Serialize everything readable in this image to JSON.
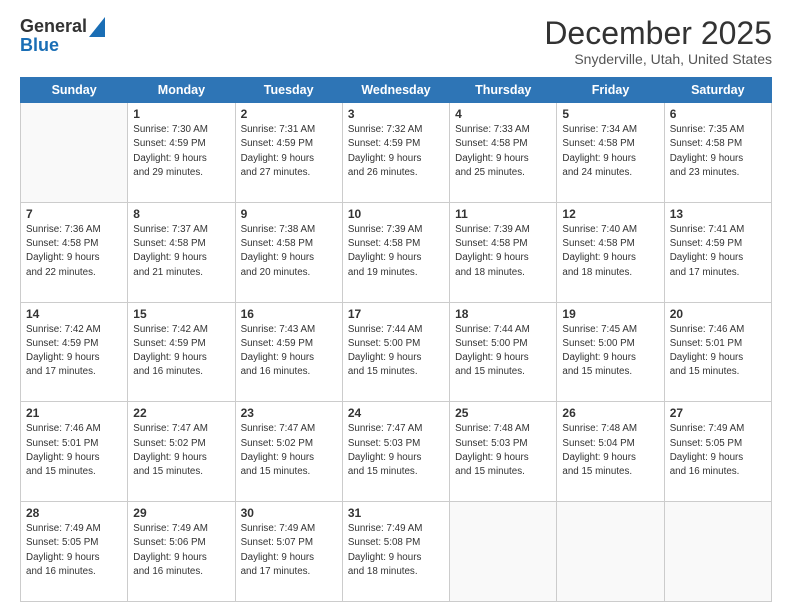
{
  "logo": {
    "line1": "General",
    "line2": "Blue"
  },
  "title": "December 2025",
  "subtitle": "Snyderville, Utah, United States",
  "days_of_week": [
    "Sunday",
    "Monday",
    "Tuesday",
    "Wednesday",
    "Thursday",
    "Friday",
    "Saturday"
  ],
  "weeks": [
    [
      {
        "day": "",
        "info": ""
      },
      {
        "day": "1",
        "info": "Sunrise: 7:30 AM\nSunset: 4:59 PM\nDaylight: 9 hours\nand 29 minutes."
      },
      {
        "day": "2",
        "info": "Sunrise: 7:31 AM\nSunset: 4:59 PM\nDaylight: 9 hours\nand 27 minutes."
      },
      {
        "day": "3",
        "info": "Sunrise: 7:32 AM\nSunset: 4:59 PM\nDaylight: 9 hours\nand 26 minutes."
      },
      {
        "day": "4",
        "info": "Sunrise: 7:33 AM\nSunset: 4:58 PM\nDaylight: 9 hours\nand 25 minutes."
      },
      {
        "day": "5",
        "info": "Sunrise: 7:34 AM\nSunset: 4:58 PM\nDaylight: 9 hours\nand 24 minutes."
      },
      {
        "day": "6",
        "info": "Sunrise: 7:35 AM\nSunset: 4:58 PM\nDaylight: 9 hours\nand 23 minutes."
      }
    ],
    [
      {
        "day": "7",
        "info": "Sunrise: 7:36 AM\nSunset: 4:58 PM\nDaylight: 9 hours\nand 22 minutes."
      },
      {
        "day": "8",
        "info": "Sunrise: 7:37 AM\nSunset: 4:58 PM\nDaylight: 9 hours\nand 21 minutes."
      },
      {
        "day": "9",
        "info": "Sunrise: 7:38 AM\nSunset: 4:58 PM\nDaylight: 9 hours\nand 20 minutes."
      },
      {
        "day": "10",
        "info": "Sunrise: 7:39 AM\nSunset: 4:58 PM\nDaylight: 9 hours\nand 19 minutes."
      },
      {
        "day": "11",
        "info": "Sunrise: 7:39 AM\nSunset: 4:58 PM\nDaylight: 9 hours\nand 18 minutes."
      },
      {
        "day": "12",
        "info": "Sunrise: 7:40 AM\nSunset: 4:58 PM\nDaylight: 9 hours\nand 18 minutes."
      },
      {
        "day": "13",
        "info": "Sunrise: 7:41 AM\nSunset: 4:59 PM\nDaylight: 9 hours\nand 17 minutes."
      }
    ],
    [
      {
        "day": "14",
        "info": "Sunrise: 7:42 AM\nSunset: 4:59 PM\nDaylight: 9 hours\nand 17 minutes."
      },
      {
        "day": "15",
        "info": "Sunrise: 7:42 AM\nSunset: 4:59 PM\nDaylight: 9 hours\nand 16 minutes."
      },
      {
        "day": "16",
        "info": "Sunrise: 7:43 AM\nSunset: 4:59 PM\nDaylight: 9 hours\nand 16 minutes."
      },
      {
        "day": "17",
        "info": "Sunrise: 7:44 AM\nSunset: 5:00 PM\nDaylight: 9 hours\nand 15 minutes."
      },
      {
        "day": "18",
        "info": "Sunrise: 7:44 AM\nSunset: 5:00 PM\nDaylight: 9 hours\nand 15 minutes."
      },
      {
        "day": "19",
        "info": "Sunrise: 7:45 AM\nSunset: 5:00 PM\nDaylight: 9 hours\nand 15 minutes."
      },
      {
        "day": "20",
        "info": "Sunrise: 7:46 AM\nSunset: 5:01 PM\nDaylight: 9 hours\nand 15 minutes."
      }
    ],
    [
      {
        "day": "21",
        "info": "Sunrise: 7:46 AM\nSunset: 5:01 PM\nDaylight: 9 hours\nand 15 minutes."
      },
      {
        "day": "22",
        "info": "Sunrise: 7:47 AM\nSunset: 5:02 PM\nDaylight: 9 hours\nand 15 minutes."
      },
      {
        "day": "23",
        "info": "Sunrise: 7:47 AM\nSunset: 5:02 PM\nDaylight: 9 hours\nand 15 minutes."
      },
      {
        "day": "24",
        "info": "Sunrise: 7:47 AM\nSunset: 5:03 PM\nDaylight: 9 hours\nand 15 minutes."
      },
      {
        "day": "25",
        "info": "Sunrise: 7:48 AM\nSunset: 5:03 PM\nDaylight: 9 hours\nand 15 minutes."
      },
      {
        "day": "26",
        "info": "Sunrise: 7:48 AM\nSunset: 5:04 PM\nDaylight: 9 hours\nand 15 minutes."
      },
      {
        "day": "27",
        "info": "Sunrise: 7:49 AM\nSunset: 5:05 PM\nDaylight: 9 hours\nand 16 minutes."
      }
    ],
    [
      {
        "day": "28",
        "info": "Sunrise: 7:49 AM\nSunset: 5:05 PM\nDaylight: 9 hours\nand 16 minutes."
      },
      {
        "day": "29",
        "info": "Sunrise: 7:49 AM\nSunset: 5:06 PM\nDaylight: 9 hours\nand 16 minutes."
      },
      {
        "day": "30",
        "info": "Sunrise: 7:49 AM\nSunset: 5:07 PM\nDaylight: 9 hours\nand 17 minutes."
      },
      {
        "day": "31",
        "info": "Sunrise: 7:49 AM\nSunset: 5:08 PM\nDaylight: 9 hours\nand 18 minutes."
      },
      {
        "day": "",
        "info": ""
      },
      {
        "day": "",
        "info": ""
      },
      {
        "day": "",
        "info": ""
      }
    ]
  ]
}
